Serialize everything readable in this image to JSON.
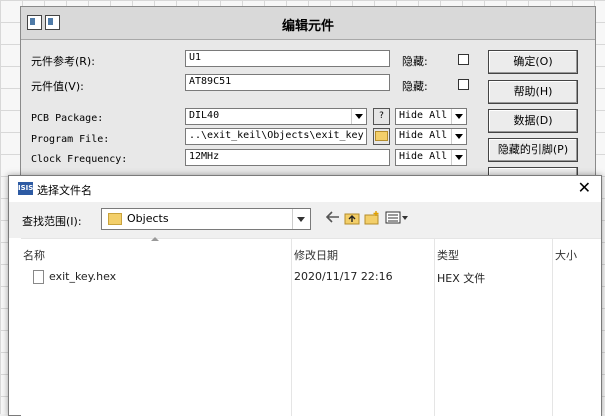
{
  "edit_dialog": {
    "title": "编辑元件",
    "fields": [
      {
        "label": "元件参考(R):",
        "value": "U1",
        "hidden_label": "隐藏:"
      },
      {
        "label": "元件值(V):",
        "value": "AT89C51",
        "hidden_label": "隐藏:"
      }
    ],
    "properties": [
      {
        "label": "PCB Package:",
        "value": "DIL40",
        "button": "?",
        "visibility": "Hide All"
      },
      {
        "label": "Program File:",
        "value": "..\\exit_keil\\Objects\\exit_key.hex",
        "visibility": "Hide All"
      },
      {
        "label": "Clock Frequency:",
        "value": "12MHz",
        "visibility": "Hide All"
      }
    ],
    "buttons": [
      "确定(O)",
      "帮助(H)",
      "数据(D)",
      "隐藏的引脚(P)"
    ]
  },
  "file_dialog": {
    "icon_text": "ISIS",
    "title": "选择文件名",
    "close_glyph": "✕",
    "look_in_label": "查找范围(I):",
    "location": "Objects",
    "columns": [
      "名称",
      "修改日期",
      "类型",
      "大小"
    ],
    "files": [
      {
        "name": "exit_key.hex",
        "modified": "2020/11/17 22:16",
        "type": "HEX 文件",
        "size": ""
      }
    ]
  }
}
